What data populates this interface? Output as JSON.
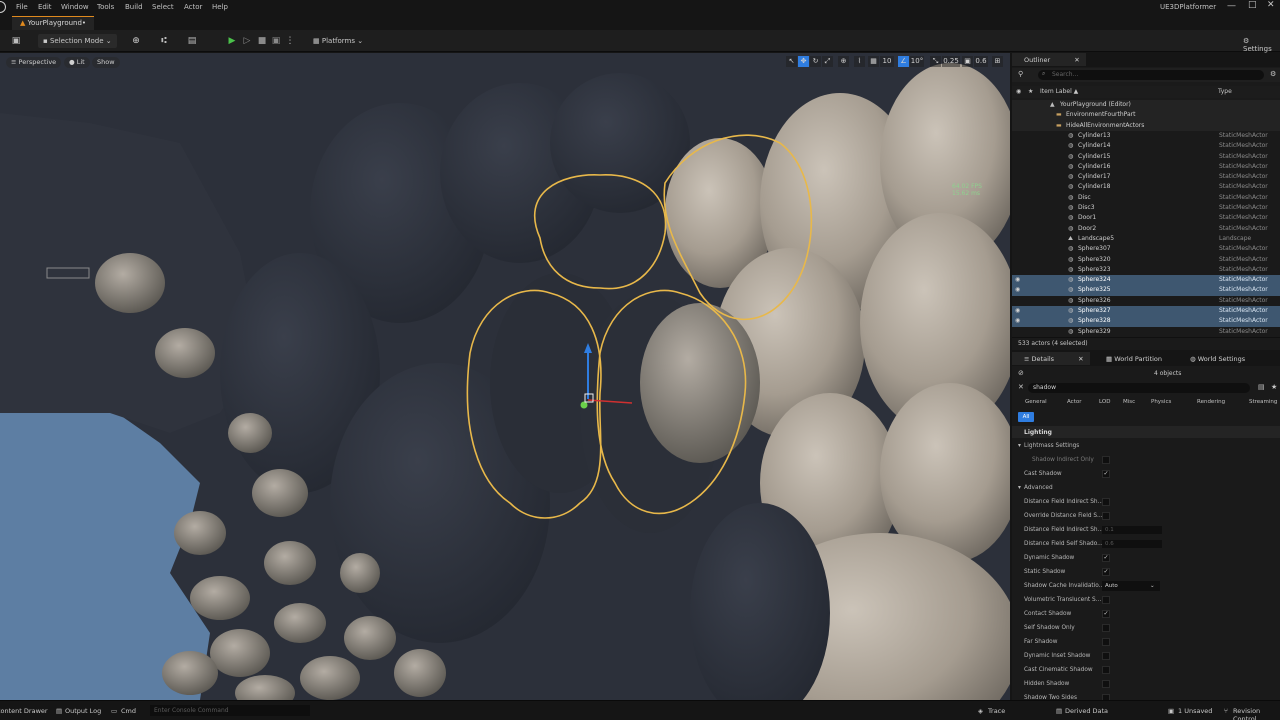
{
  "menu": [
    "File",
    "Edit",
    "Window",
    "Tools",
    "Build",
    "Select",
    "Actor",
    "Help"
  ],
  "project_tab": "YourPlayground•",
  "app_name": "UE3DPlatformer",
  "toolbar": {
    "selection_mode": "Selection Mode",
    "platforms": "Platforms",
    "settings": "Settings"
  },
  "viewport": {
    "chips": [
      "Perspective",
      "Lit",
      "Show"
    ],
    "grid_value": "10",
    "angle_value": "10°",
    "scale_value": "0.25",
    "camera_speed": "0.6",
    "fps": "64.02 FPS",
    "ms": "15.62 ms"
  },
  "outliner": {
    "title": "Outliner",
    "search_placeholder": "Search...",
    "col_label": "Item Label ▲",
    "col_type": "Type",
    "rows": [
      {
        "name": "YourPlayground (Editor)",
        "type": "",
        "indent": 48,
        "icon": "world",
        "selected": false
      },
      {
        "name": "EnvironmentFourthPart",
        "type": "",
        "indent": 54,
        "icon": "folder",
        "selected": false
      },
      {
        "name": "HideAllEnvironmentActors",
        "type": "",
        "indent": 54,
        "icon": "folder",
        "selected": false
      },
      {
        "name": "Cylinder13",
        "type": "StaticMeshActor",
        "indent": 66,
        "icon": "mesh",
        "selected": false
      },
      {
        "name": "Cylinder14",
        "type": "StaticMeshActor",
        "indent": 66,
        "icon": "mesh",
        "selected": false
      },
      {
        "name": "Cylinder15",
        "type": "StaticMeshActor",
        "indent": 66,
        "icon": "mesh",
        "selected": false
      },
      {
        "name": "Cylinder16",
        "type": "StaticMeshActor",
        "indent": 66,
        "icon": "mesh",
        "selected": false
      },
      {
        "name": "Cylinder17",
        "type": "StaticMeshActor",
        "indent": 66,
        "icon": "mesh",
        "selected": false
      },
      {
        "name": "Cylinder18",
        "type": "StaticMeshActor",
        "indent": 66,
        "icon": "mesh",
        "selected": false
      },
      {
        "name": "Disc",
        "type": "StaticMeshActor",
        "indent": 66,
        "icon": "mesh",
        "selected": false
      },
      {
        "name": "Disc3",
        "type": "StaticMeshActor",
        "indent": 66,
        "icon": "mesh",
        "selected": false
      },
      {
        "name": "Door1",
        "type": "StaticMeshActor",
        "indent": 66,
        "icon": "mesh",
        "selected": false
      },
      {
        "name": "Door2",
        "type": "StaticMeshActor",
        "indent": 66,
        "icon": "mesh",
        "selected": false
      },
      {
        "name": "Landscape5",
        "type": "Landscape",
        "indent": 66,
        "icon": "landscape",
        "selected": false
      },
      {
        "name": "Sphere307",
        "type": "StaticMeshActor",
        "indent": 66,
        "icon": "mesh",
        "selected": false
      },
      {
        "name": "Sphere320",
        "type": "StaticMeshActor",
        "indent": 66,
        "icon": "mesh",
        "selected": false
      },
      {
        "name": "Sphere323",
        "type": "StaticMeshActor",
        "indent": 66,
        "icon": "mesh",
        "selected": false
      },
      {
        "name": "Sphere324",
        "type": "StaticMeshActor",
        "indent": 66,
        "icon": "mesh",
        "selected": true
      },
      {
        "name": "Sphere325",
        "type": "StaticMeshActor",
        "indent": 66,
        "icon": "mesh",
        "selected": true
      },
      {
        "name": "Sphere326",
        "type": "StaticMeshActor",
        "indent": 66,
        "icon": "mesh",
        "selected": false
      },
      {
        "name": "Sphere327",
        "type": "StaticMeshActor",
        "indent": 66,
        "icon": "mesh",
        "selected": true
      },
      {
        "name": "Sphere328",
        "type": "StaticMeshActor",
        "indent": 66,
        "icon": "mesh",
        "selected": true
      },
      {
        "name": "Sphere329",
        "type": "StaticMeshActor",
        "indent": 66,
        "icon": "mesh",
        "selected": false
      }
    ],
    "footer": "533 actors (4 selected)"
  },
  "details": {
    "tabs": [
      "Details",
      "World Partition",
      "World Settings"
    ],
    "objects": "4 objects",
    "search_value": "shadow",
    "categories": [
      "General",
      "Actor",
      "LOD",
      "Misc",
      "Physics",
      "Rendering",
      "Streaming"
    ],
    "all_label": "All",
    "section": "Lighting",
    "sub_lightmass": "Lightmass Settings",
    "sub_advanced": "Advanced",
    "props": [
      {
        "label": "Shadow Indirect Only",
        "kind": "check",
        "checked": false,
        "indent": 20,
        "dim": true
      },
      {
        "label": "Cast Shadow",
        "kind": "check",
        "checked": true,
        "indent": 12,
        "dim": false
      },
      {
        "label": "Distance Field Indirect Sh...",
        "kind": "check",
        "checked": false,
        "indent": 12,
        "dim": false
      },
      {
        "label": "Override Distance Field S...",
        "kind": "check",
        "checked": false,
        "indent": 12,
        "dim": false
      },
      {
        "label": "Distance Field Indirect Sh...",
        "kind": "value",
        "value": "0.1",
        "indent": 12,
        "dim": false
      },
      {
        "label": "Distance Field Self Shado...",
        "kind": "value",
        "value": "0.6",
        "indent": 12,
        "dim": false
      },
      {
        "label": "Dynamic Shadow",
        "kind": "check",
        "checked": true,
        "indent": 12,
        "dim": false
      },
      {
        "label": "Static Shadow",
        "kind": "check",
        "checked": true,
        "indent": 12,
        "dim": false
      },
      {
        "label": "Shadow Cache Invalidatio...",
        "kind": "select",
        "value": "Auto",
        "indent": 12,
        "dim": false
      },
      {
        "label": "Volumetric Translucent S...",
        "kind": "check",
        "checked": false,
        "indent": 12,
        "dim": false
      },
      {
        "label": "Contact Shadow",
        "kind": "check",
        "checked": true,
        "indent": 12,
        "dim": false
      },
      {
        "label": "Self Shadow Only",
        "kind": "check",
        "checked": false,
        "indent": 12,
        "dim": false
      },
      {
        "label": "Far Shadow",
        "kind": "check",
        "checked": false,
        "indent": 12,
        "dim": false
      },
      {
        "label": "Dynamic Inset Shadow",
        "kind": "check",
        "checked": false,
        "indent": 12,
        "dim": false
      },
      {
        "label": "Cast Cinematic Shadow",
        "kind": "check",
        "checked": false,
        "indent": 12,
        "dim": false
      },
      {
        "label": "Hidden Shadow",
        "kind": "check",
        "checked": false,
        "indent": 12,
        "dim": false
      },
      {
        "label": "Shadow Two Sides",
        "kind": "check",
        "checked": false,
        "indent": 12,
        "dim": false
      }
    ]
  },
  "statusbar": {
    "content_drawer": "Content Drawer",
    "output_log": "Output Log",
    "cmd": "Cmd",
    "console_placeholder": "Enter Console Command",
    "trace": "Trace",
    "derived_data": "Derived Data",
    "unsaved": "1 Unsaved",
    "revision": "Revision Control"
  },
  "colors": {
    "selection_outline": "#e8b84a",
    "selected_row": "#3e5770",
    "accent_blue": "#2f7de0",
    "play_green": "#4bc24b"
  }
}
